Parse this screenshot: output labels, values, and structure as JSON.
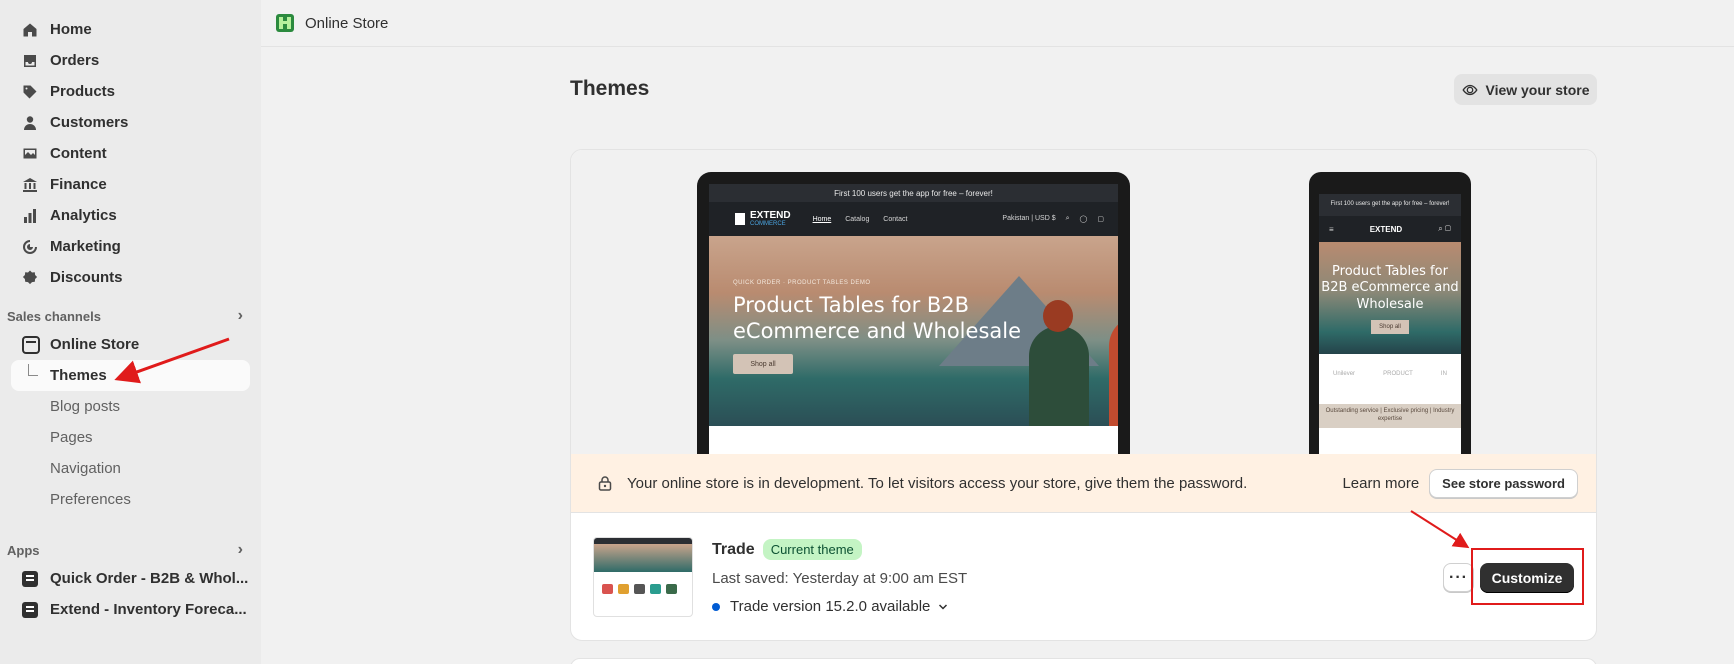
{
  "sidebar": {
    "nav": [
      {
        "label": "Home",
        "icon": "home-icon"
      },
      {
        "label": "Orders",
        "icon": "inbox-icon"
      },
      {
        "label": "Products",
        "icon": "tag-icon"
      },
      {
        "label": "Customers",
        "icon": "person-icon"
      },
      {
        "label": "Content",
        "icon": "image-icon"
      },
      {
        "label": "Finance",
        "icon": "bank-icon"
      },
      {
        "label": "Analytics",
        "icon": "bar-chart-icon"
      },
      {
        "label": "Marketing",
        "icon": "target-icon"
      },
      {
        "label": "Discounts",
        "icon": "discount-icon"
      }
    ],
    "sales_channels_heading": "Sales channels",
    "online_store_label": "Online Store",
    "sub_items": [
      "Themes",
      "Blog posts",
      "Pages",
      "Navigation",
      "Preferences"
    ],
    "apps_heading": "Apps",
    "apps": [
      "Quick Order - B2B & Whol...",
      "Extend - Inventory Foreca..."
    ]
  },
  "topbar": {
    "title": "Online Store"
  },
  "page": {
    "title": "Themes",
    "view_store_label": "View your store"
  },
  "preview": {
    "announcement": "First 100 users get the app for free – forever!",
    "brand": "EXTEND",
    "brand_sub": "COMMERCE",
    "menu": [
      "Home",
      "Catalog",
      "Contact"
    ],
    "locale": "Pakistan | USD $",
    "kicker": "QUICK ORDER · PRODUCT TABLES DEMO",
    "hero_title": "Product Tables for B2B eCommerce and Wholesale",
    "hero_button": "Shop all",
    "phone_logos": [
      "Unilever",
      "PRODUCT",
      "IN"
    ],
    "phone_band": "Outstanding service | Exclusive pricing | Industry expertise"
  },
  "dev_banner": {
    "message": "Your online store is in development. To let visitors access your store, give them the password.",
    "learn_more": "Learn more",
    "password_button": "See store password"
  },
  "theme": {
    "name": "Trade",
    "badge": "Current theme",
    "last_saved": "Last saved: Yesterday at 9:00 am EST",
    "version": "Trade version 15.2.0 available",
    "more_label": "···",
    "customize_label": "Customize"
  },
  "colors": {
    "accent_dark": "#303030",
    "badge_bg": "#c4f4c4",
    "banner_bg": "#fff1e3",
    "annotation_red": "#e01b1b",
    "version_dot": "#005bd3"
  }
}
